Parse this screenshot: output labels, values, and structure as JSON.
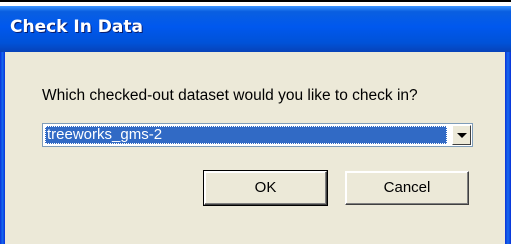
{
  "window": {
    "title": "Check In Data"
  },
  "dialog": {
    "prompt": "Which checked-out dataset would you like to check in?",
    "dataset_select": {
      "selected_value": "treeworks_gms-2"
    },
    "ok_label": "OK",
    "cancel_label": "Cancel"
  },
  "colors": {
    "titlebar": "#0058ee",
    "client_background": "#ece9d8",
    "selection_highlight": "#316ac5"
  },
  "icons": {
    "dropdown": "chevron-down-icon"
  }
}
